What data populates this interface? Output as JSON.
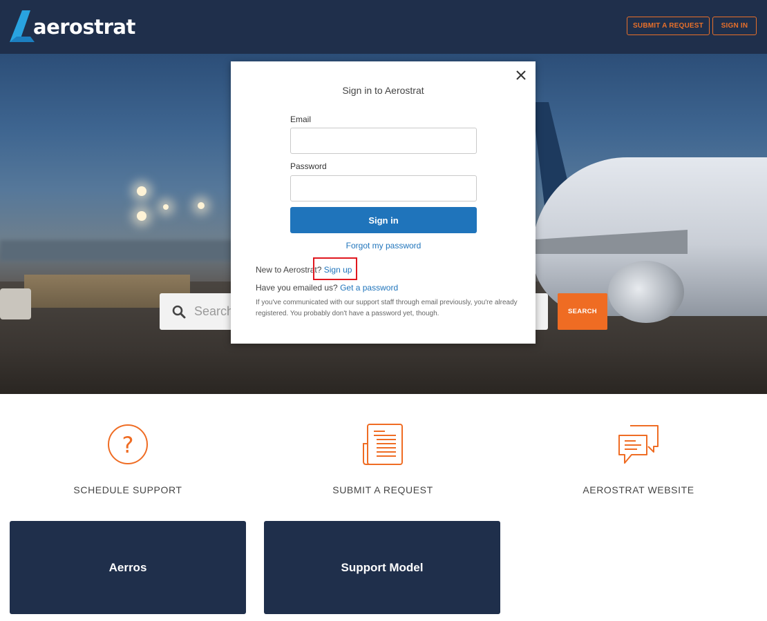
{
  "header": {
    "logo_text": "aerostrat",
    "submit_request_label": "SUBMIT A REQUEST",
    "sign_in_label": "SIGN IN"
  },
  "hero": {
    "search_placeholder": "Search",
    "search_button_label": "SEARCH"
  },
  "modal": {
    "title": "Sign in to Aerostrat",
    "email_label": "Email",
    "email_value": "",
    "password_label": "Password",
    "password_value": "",
    "sign_in_button_label": "Sign in",
    "forgot_password_label": "Forgot my password",
    "new_user_prefix": "New to Aerostrat?",
    "sign_up_label": "Sign up",
    "emailed_prefix": "Have you emailed us?",
    "get_password_label": "Get a password",
    "note": "If you've communicated with our support staff through email previously, you're already registered. You probably don't have a password yet, though."
  },
  "features": [
    {
      "label": "SCHEDULE SUPPORT",
      "icon": "question-circle-icon"
    },
    {
      "label": "SUBMIT A REQUEST",
      "icon": "document-icon"
    },
    {
      "label": "AEROSTRAT WEBSITE",
      "icon": "chat-bubbles-icon"
    }
  ],
  "cards": [
    {
      "label": "Aerros"
    },
    {
      "label": "Support Model"
    }
  ],
  "colors": {
    "header_bg": "#1f2f4b",
    "accent_orange": "#ef6c23",
    "link_blue": "#1f74bb",
    "highlight_red": "#e0161e"
  }
}
